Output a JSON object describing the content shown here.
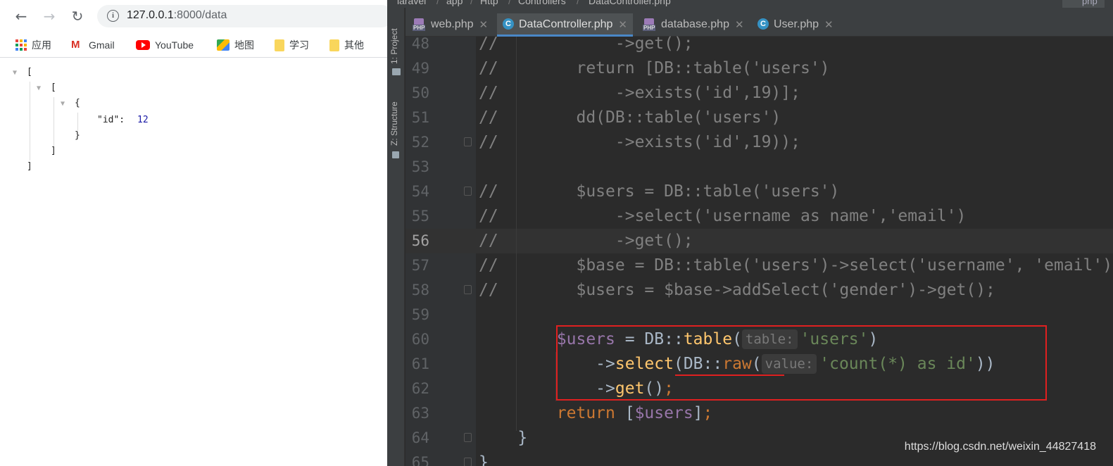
{
  "browser": {
    "nav": {
      "back": "←",
      "forward": "→",
      "reload": "↻"
    },
    "omnibox": {
      "info": "i",
      "url_host": "127.0.0.1",
      "url_path": ":8000/data"
    },
    "bookmarks": [
      {
        "label": "应用",
        "icon": "apps-icon"
      },
      {
        "label": "Gmail",
        "icon": "gmail-icon"
      },
      {
        "label": "YouTube",
        "icon": "youtube-icon"
      },
      {
        "label": "地图",
        "icon": "maps-icon"
      },
      {
        "label": "学习",
        "icon": "folder-icon"
      },
      {
        "label": "其他",
        "icon": "folder-icon"
      }
    ],
    "json": {
      "open_outer": "[",
      "open_inner": "[",
      "open_obj": "{",
      "key": "\"id\":",
      "value": "12",
      "close_obj": "}",
      "close_inner": "]",
      "close_outer": "]"
    }
  },
  "ide": {
    "breadcrumbs": [
      "laravel",
      "app",
      "Http",
      "Controllers",
      "DataController.php"
    ],
    "breadcrumb_badge": "php",
    "side_tabs": {
      "project": "1: Project",
      "structure": "Z: Structure"
    },
    "tabs": [
      {
        "label": "web.php",
        "icon": "php-file-icon",
        "active": false
      },
      {
        "label": "DataController.php",
        "icon": "class-icon",
        "active": true
      },
      {
        "label": "database.php",
        "icon": "php-file-icon",
        "active": false
      },
      {
        "label": "User.php",
        "icon": "class-icon",
        "active": false
      }
    ],
    "current_line": "56",
    "lines": [
      {
        "n": "48",
        "comment": "//",
        "code": "            ->get();"
      },
      {
        "n": "49",
        "comment": "//",
        "code": "        return [DB::table('users')"
      },
      {
        "n": "50",
        "comment": "//",
        "code": "            ->exists('id',19)];"
      },
      {
        "n": "51",
        "comment": "//",
        "code": "        dd(DB::table('users')"
      },
      {
        "n": "52",
        "comment": "//",
        "code": "            ->exists('id',19));"
      },
      {
        "n": "53",
        "comment": "",
        "code": ""
      },
      {
        "n": "54",
        "comment": "//",
        "code": "        $users = DB::table('users')"
      },
      {
        "n": "55",
        "comment": "//",
        "code": "            ->select('username as name','email')"
      },
      {
        "n": "56",
        "comment": "//",
        "code": "            ->get();"
      },
      {
        "n": "57",
        "comment": "//",
        "code": "        $base = DB::table('users')->select('username', 'email')"
      },
      {
        "n": "58",
        "comment": "//",
        "code": "        $users = $base->addSelect('gender')->get();"
      },
      {
        "n": "59",
        "comment": "",
        "code": ""
      },
      {
        "n": "60"
      },
      {
        "n": "61"
      },
      {
        "n": "62"
      },
      {
        "n": "63"
      },
      {
        "n": "64"
      },
      {
        "n": "65"
      }
    ],
    "active_code": {
      "l60": {
        "var": "$users",
        "op1": " = DB::",
        "fn": "table",
        "paren": "(",
        "hint": "table:",
        "str": "'users'",
        "close": ")"
      },
      "l61": {
        "arrow": "->",
        "fn": "select",
        "paren": "(DB::",
        "fn2": "raw",
        "paren2": "(",
        "hint": "value:",
        "str": "'count(*) as id'",
        "close": "))"
      },
      "l62": {
        "arrow": "->",
        "fn": "get",
        "parens": "()",
        "semi": ";"
      },
      "l63": {
        "kw": "return",
        "open": " [",
        "var": "$users",
        "close": "]",
        "semi": ";"
      },
      "l64": {
        "brace": "}"
      },
      "l65": {
        "brace": "}"
      }
    }
  },
  "watermark": "https://blog.csdn.net/weixin_44827418",
  "colors": {
    "highlight_box": "#e02020",
    "editor_bg": "#2b2b2b",
    "keyword": "#cc7832",
    "string": "#6a8759",
    "variable": "#9876aa",
    "function": "#ffc66d"
  }
}
